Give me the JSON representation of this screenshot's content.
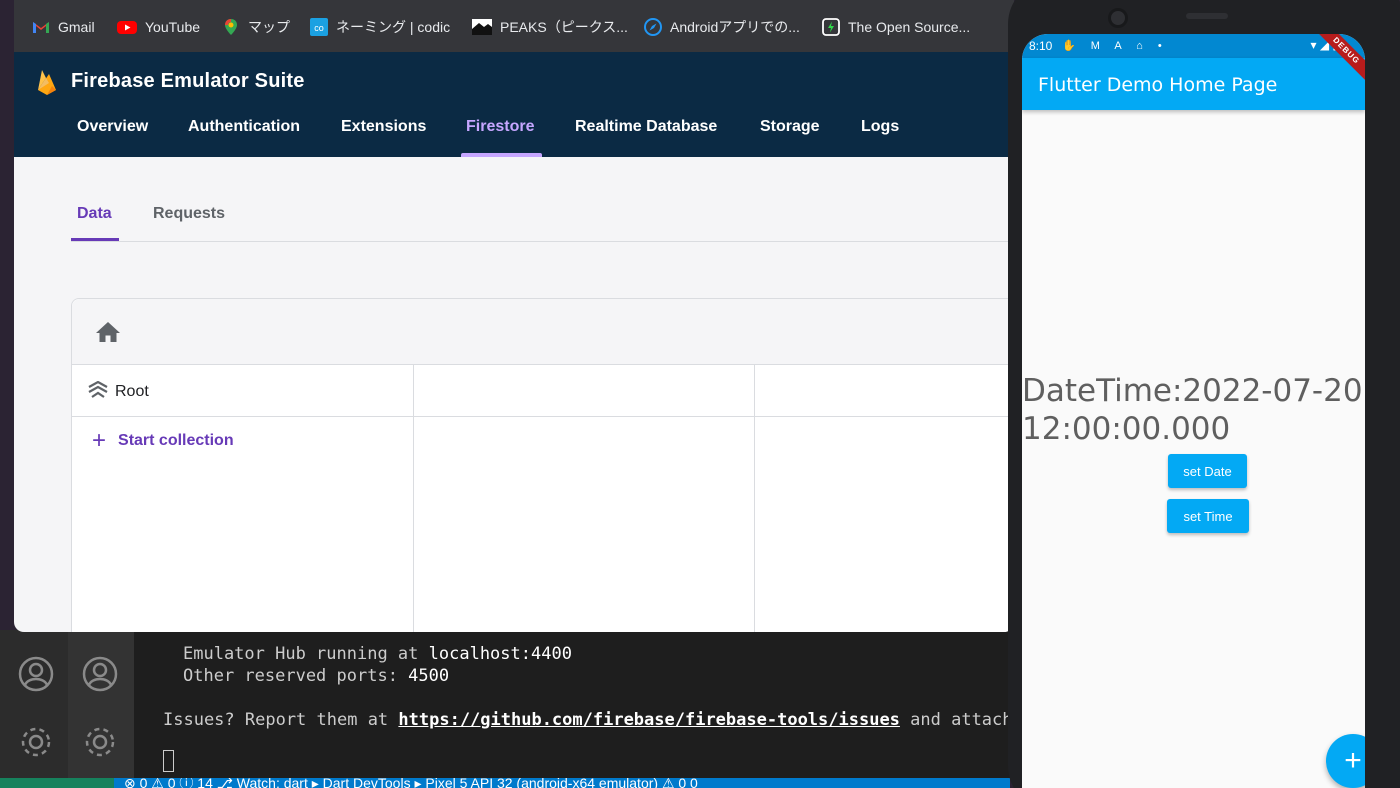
{
  "bookmarks": [
    {
      "label": "Gmail",
      "icon": "gmail-icon",
      "color": "#ea4335"
    },
    {
      "label": "YouTube",
      "icon": "youtube-icon",
      "color": "#ff0000"
    },
    {
      "label": "マップ",
      "icon": "maps-icon",
      "color": "#34a853"
    },
    {
      "label": "ネーミング | codic",
      "icon": "codic-icon",
      "color": "#1ba1e2"
    },
    {
      "label": "PEAKS（ピークス...",
      "icon": "peaks-icon",
      "color": "#ffffff"
    },
    {
      "label": "Androidアプリでの...",
      "icon": "compass-icon",
      "color": "#2196f3"
    },
    {
      "label": "The Open Source...",
      "icon": "opensource-icon",
      "color": "#ffffff"
    }
  ],
  "firebase": {
    "title": "Firebase Emulator Suite",
    "nav": [
      "Overview",
      "Authentication",
      "Extensions",
      "Firestore",
      "Realtime Database",
      "Storage",
      "Logs"
    ],
    "active_nav": "Firestore",
    "subtabs": [
      "Data",
      "Requests"
    ],
    "active_subtab": "Data",
    "root_label": "Root",
    "start_collection": "Start collection",
    "colors": {
      "header": "#0b2a44",
      "accent": "#c6a6ff",
      "primary": "#673ab7"
    }
  },
  "terminal": {
    "hub_prefix": "Emulator Hub running at ",
    "hub_value": "localhost:4400",
    "ports_prefix": "Other reserved ports: ",
    "ports_value": "4500",
    "issues_prefix": "Issues? Report them at ",
    "issues_link": "https://github.com/firebase/firebase-tools/issues",
    "issues_suffix": " and attach"
  },
  "statusbar": {
    "text": "⊗ 0 ⚠ 0 ⓘ 14    ⎇ Watch: dart ▸ Dart DevTools ▸ Pixel 5 API 32 (android-x64 emulator)  ⚠ 0 0"
  },
  "phone": {
    "status_time": "8:10",
    "app_title": "Flutter Demo Home Page",
    "datetime_line1": "DateTime:2022-07-20",
    "datetime_line2": "12:00:00.000",
    "set_date_label": "set Date",
    "set_time_label": "set Time",
    "fab_label": "+",
    "debug_banner": "DEBUG",
    "colors": {
      "primary": "#03a9f4",
      "status": "#0288d1"
    }
  }
}
